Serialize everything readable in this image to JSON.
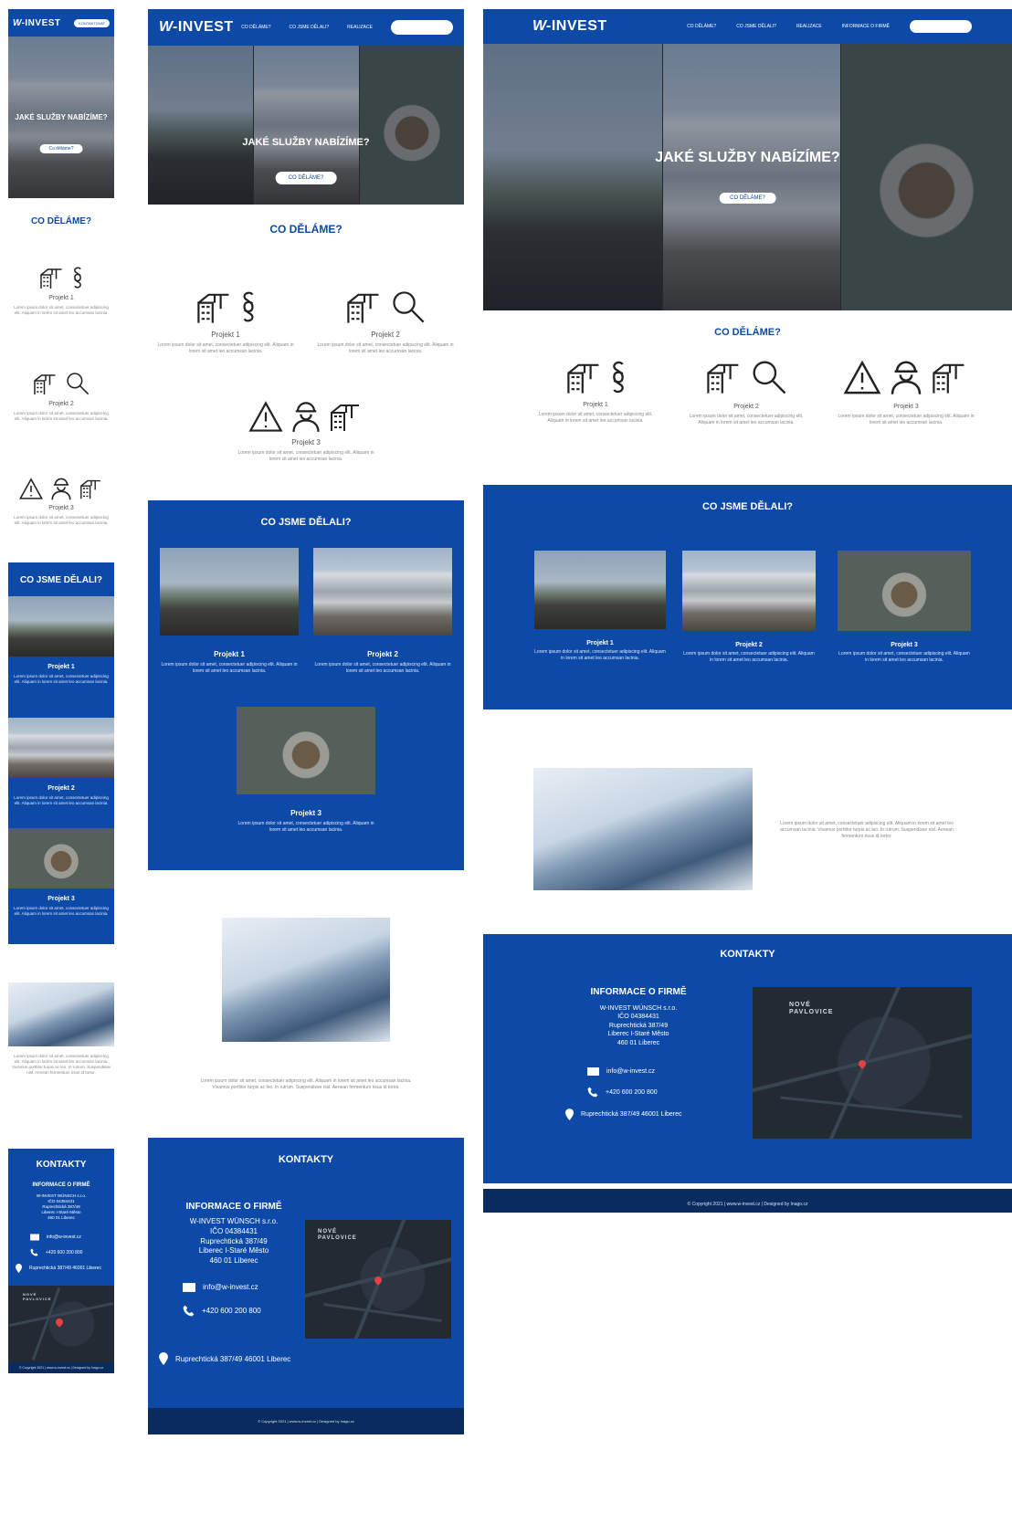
{
  "brand": {
    "logo_w": "W-",
    "logo_rest": "INVEST",
    "primary": "#0d4aa8",
    "footer": "#0a2b5e"
  },
  "nav": {
    "items": [
      "CO DĚLÁME?",
      "CO JSME DĚLALI?",
      "REALIZACE",
      "INFORMACE O FIRMĚ"
    ],
    "cta": "KONTAKTOVAT"
  },
  "hero": {
    "title": "JAKÉ SLUŽBY NABÍZÍME?",
    "button_upper": "CO DĚLÁME?",
    "button_mixed": "Co děláme?"
  },
  "what_we_do": {
    "title": "CO DĚLÁME?",
    "projects": [
      {
        "title": "Projekt 1",
        "icons": [
          "crane-building-icon",
          "paragraph-icon"
        ],
        "text": "Lorem ipsum dolor sit amet, consectetuer adipiscing elit. Aliquam in lorem sit amet leo accumsan lacinia."
      },
      {
        "title": "Projekt 2",
        "icons": [
          "crane-building-icon",
          "magnifier-icon"
        ],
        "text": "Lorem ipsum dolor sit amet, consectetuer adipiscing elit. Aliquam in lorem sit amet leo accumsan lacinia."
      },
      {
        "title": "Projekt 3",
        "icons": [
          "warning-icon",
          "worker-icon",
          "crane-building-icon"
        ],
        "text": "Lorem ipsum dolor sit amet, consectetuer adipiscing elit. Aliquam in lorem sit amet leo accumsan lacinia."
      }
    ]
  },
  "what_we_did": {
    "title": "CO JSME DĚLALI?",
    "projects": [
      {
        "title": "Projekt 1",
        "photo": "road-photo",
        "text": "Lorem ipsum dolor sit amet, consectetuer adipiscing elit. Aliquam in lorem sit amet leo accumsan lacinia."
      },
      {
        "title": "Projekt 2",
        "photo": "building-photo",
        "text": "Lorem ipsum dolor sit amet, consectetuer adipiscing elit. Aliquam in lorem sit amet leo accumsan lacinia."
      },
      {
        "title": "Projekt 3",
        "photo": "roundabout-photo",
        "text": "Lorem ipsum dolor sit amet, consectetuer adipiscing elit. Aliquam in lorem sit amet leo accumsan lacinia."
      }
    ]
  },
  "about": {
    "text": "Lorem ipsum dolor sit amet, consectetuer adipiscing elit. Aliquam in lorem sit amet leo accumsan lacinia. Vivamus porttitor turpis ac leo. In rutrum. Suspendisse nisl. Aenean fermentum risus id tortor."
  },
  "contacts": {
    "title": "KONTAKTY",
    "info_title": "INFORMACE O FIRMĚ",
    "company": "W-INVEST WÜNSCH s.r.o.",
    "ico": "IČO 04384431",
    "street": "Ruprechtická 387/49",
    "district": "Liberec I-Staré Město",
    "zip": "460 01 Liberec",
    "email": "info@w-invest.cz",
    "phone": "+420 600 200 800",
    "address": "Ruprechtická 387/49 46001 Liberec",
    "map_label_1": "NOVÉ",
    "map_label_2": "PAVLOVICE"
  },
  "footer": {
    "text": "© Copyright 2021 | www.w-invest.cz | Designed by Inago.cz"
  }
}
